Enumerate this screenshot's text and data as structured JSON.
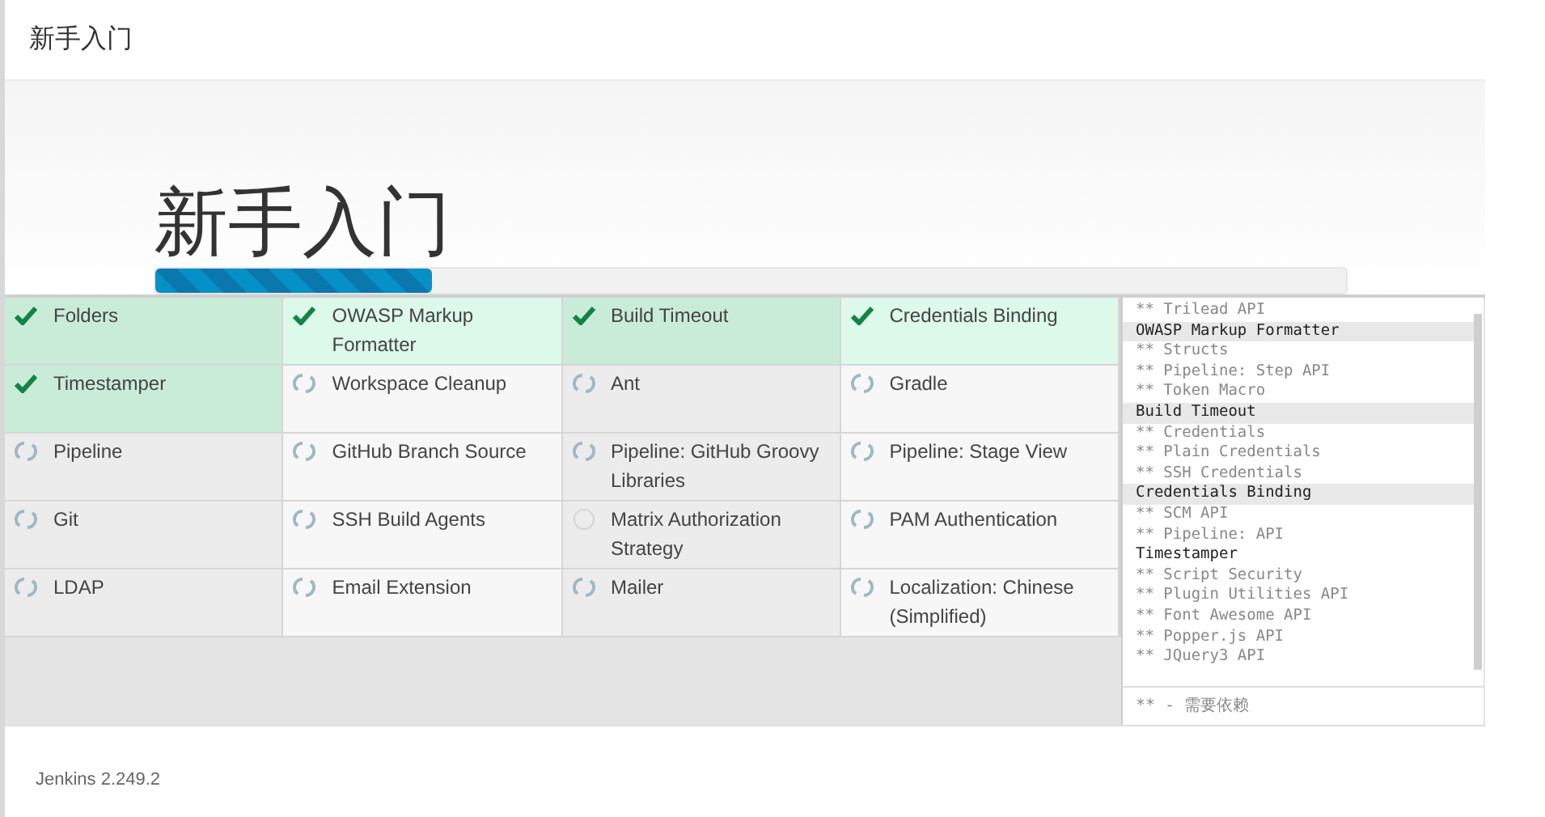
{
  "header": {
    "title": "新手入门"
  },
  "hero": {
    "title": "新手入门"
  },
  "progress": {
    "level": 0.233
  },
  "plugins": [
    {
      "name": "Folders",
      "kind": "done"
    },
    {
      "name": "OWASP Markup Formatter",
      "kind": "done"
    },
    {
      "name": "Build Timeout",
      "kind": "done"
    },
    {
      "name": "Credentials Binding",
      "kind": "done"
    },
    {
      "name": "Timestamper",
      "kind": "done"
    },
    {
      "name": "Workspace Cleanup",
      "kind": "pending"
    },
    {
      "name": "Ant",
      "kind": "pending"
    },
    {
      "name": "Gradle",
      "kind": "pending"
    },
    {
      "name": "Pipeline",
      "kind": "pending"
    },
    {
      "name": "GitHub Branch Source",
      "kind": "pending"
    },
    {
      "name": "Pipeline: GitHub Groovy Libraries",
      "kind": "pending"
    },
    {
      "name": "Pipeline: Stage View",
      "kind": "pending"
    },
    {
      "name": "Git",
      "kind": "pending"
    },
    {
      "name": "SSH Build Agents",
      "kind": "pending"
    },
    {
      "name": "Matrix Authorization Strategy",
      "kind": "waiting"
    },
    {
      "name": "PAM Authentication",
      "kind": "pending"
    },
    {
      "name": "LDAP",
      "kind": "pending"
    },
    {
      "name": "Email Extension",
      "kind": "pending"
    },
    {
      "name": "Mailer",
      "kind": "pending"
    },
    {
      "name": "Localization: Chinese (Simplified)",
      "kind": "pending"
    }
  ],
  "log": {
    "lines": [
      {
        "text": "** Trilead API",
        "kind": "dependency",
        "shaded": false
      },
      {
        "text": "OWASP Markup Formatter",
        "kind": "plugin",
        "shaded": true
      },
      {
        "text": "** Structs",
        "kind": "dependency",
        "shaded": false
      },
      {
        "text": "** Pipeline: Step API",
        "kind": "dependency",
        "shaded": false
      },
      {
        "text": "** Token Macro",
        "kind": "dependency",
        "shaded": false
      },
      {
        "text": "Build Timeout",
        "kind": "plugin",
        "shaded": true
      },
      {
        "text": "** Credentials",
        "kind": "dependency",
        "shaded": false
      },
      {
        "text": "** Plain Credentials",
        "kind": "dependency",
        "shaded": false
      },
      {
        "text": "** SSH Credentials",
        "kind": "dependency",
        "shaded": false
      },
      {
        "text": "Credentials Binding",
        "kind": "plugin",
        "shaded": true
      },
      {
        "text": "** SCM API",
        "kind": "dependency",
        "shaded": false
      },
      {
        "text": "** Pipeline: API",
        "kind": "dependency",
        "shaded": false
      },
      {
        "text": "Timestamper",
        "kind": "plugin",
        "shaded": false
      },
      {
        "text": "** Script Security",
        "kind": "dependency",
        "shaded": false
      },
      {
        "text": "** Plugin Utilities API",
        "kind": "dependency",
        "shaded": false
      },
      {
        "text": "** Font Awesome API",
        "kind": "dependency",
        "shaded": false
      },
      {
        "text": "** Popper.js API",
        "kind": "dependency",
        "shaded": false
      },
      {
        "text": "** JQuery3 API",
        "kind": "dependency",
        "shaded": false
      }
    ],
    "legend": "** - 需要依赖"
  },
  "footer": {
    "version": "Jenkins 2.249.2"
  }
}
